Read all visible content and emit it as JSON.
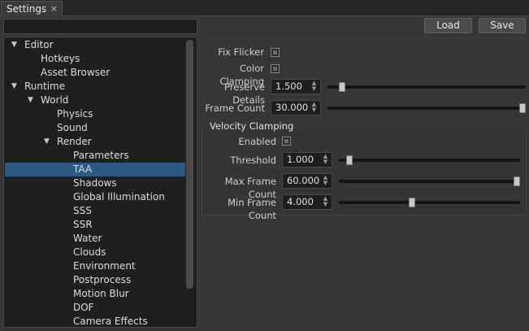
{
  "window": {
    "tab_label": "Settings",
    "tab_close": "×"
  },
  "search": {
    "value": ""
  },
  "tree": {
    "items": [
      {
        "label": "Editor",
        "depth": 0,
        "expanded": true
      },
      {
        "label": "Hotkeys",
        "depth": 1
      },
      {
        "label": "Asset Browser",
        "depth": 1
      },
      {
        "label": "Runtime",
        "depth": 0,
        "expanded": true
      },
      {
        "label": "World",
        "depth": 1,
        "expanded": true
      },
      {
        "label": "Physics",
        "depth": 2
      },
      {
        "label": "Sound",
        "depth": 2
      },
      {
        "label": "Render",
        "depth": 2,
        "expanded": true
      },
      {
        "label": "Parameters",
        "depth": 3
      },
      {
        "label": "TAA",
        "depth": 3,
        "selected": true
      },
      {
        "label": "Shadows",
        "depth": 3
      },
      {
        "label": "Global Illumination",
        "depth": 3
      },
      {
        "label": "SSS",
        "depth": 3
      },
      {
        "label": "SSR",
        "depth": 3
      },
      {
        "label": "Water",
        "depth": 3
      },
      {
        "label": "Clouds",
        "depth": 3
      },
      {
        "label": "Environment",
        "depth": 3
      },
      {
        "label": "Postprocess",
        "depth": 3
      },
      {
        "label": "Motion Blur",
        "depth": 3
      },
      {
        "label": "DOF",
        "depth": 3
      },
      {
        "label": "Camera Effects",
        "depth": 3
      }
    ]
  },
  "toolbar": {
    "load_label": "Load",
    "save_label": "Save"
  },
  "taa": {
    "fix_flicker": {
      "label": "Fix Flicker",
      "checked": false
    },
    "color_clamping": {
      "label": "Color Clamping",
      "checked": false
    },
    "preserve_details": {
      "label": "Preserve Details",
      "value": "1.500",
      "fraction": 0.06
    },
    "frame_count": {
      "label": "Frame Count",
      "value": "30.000",
      "fraction": 1.0
    },
    "velocity_clamping": {
      "title": "Velocity Clamping",
      "enabled": {
        "label": "Enabled",
        "checked": false
      },
      "threshold": {
        "label": "Threshold",
        "value": "1.000",
        "fraction": 0.04
      },
      "max_frame_count": {
        "label": "Max Frame Count",
        "value": "60.000",
        "fraction": 1.0
      },
      "min_frame_count": {
        "label": "Min Frame Count",
        "value": "4.000",
        "fraction": 0.4
      }
    }
  },
  "colors": {
    "selection": "#2d5a85",
    "background": "#363636",
    "panel": "#1f1f1f"
  }
}
